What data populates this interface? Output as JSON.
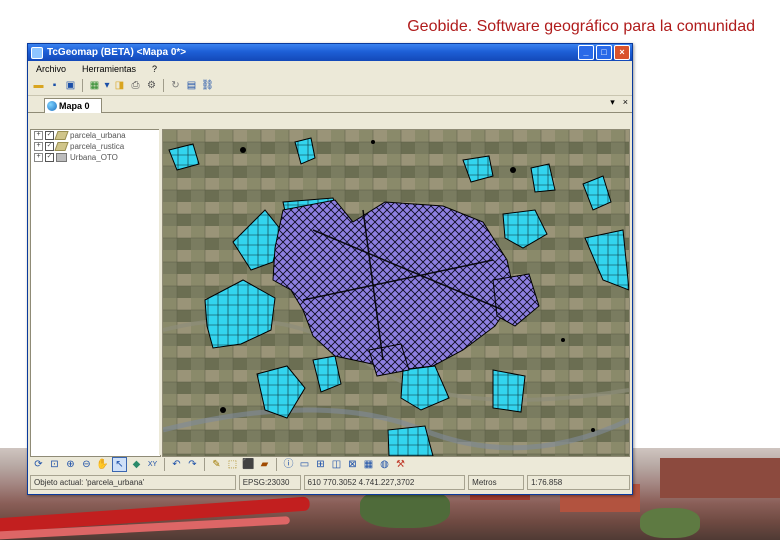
{
  "slide_title": "Geobide. Software geográfico para la comunidad",
  "window": {
    "title": "TcGeomap (BETA) <Mapa 0*>"
  },
  "window_controls": {
    "minimize": "_",
    "maximize": "□",
    "close": "×"
  },
  "menu": [
    "Archivo",
    "Herramientas",
    "?"
  ],
  "document_tab": {
    "label": "Mapa 0",
    "dropdown": "▾",
    "close": "×"
  },
  "layers": [
    {
      "name": "parcela_urbana",
      "checked": true,
      "type": "polygon"
    },
    {
      "name": "parcela_rustica",
      "checked": true,
      "type": "polygon"
    },
    {
      "name": "Urbana_OTO",
      "checked": true,
      "type": "raster"
    }
  ],
  "statusbar": {
    "selected_object": "Objeto actual: 'parcela_urbana'",
    "crs": "EPSG:23030",
    "coordinates": "610 770.3052 4.741.227,3702",
    "units": "Metros",
    "scale": "1:76.858"
  },
  "icons": {
    "toolbar": [
      "open-folder-icon",
      "save-icon",
      "save-as-icon",
      "add-layer-icon",
      "open-project-icon",
      "print-icon",
      "settings-icon",
      "refresh-icon",
      "table-icon",
      "link-icon"
    ],
    "map_tools": [
      "refresh-map-icon",
      "zoom-window-icon",
      "zoom-in-icon",
      "zoom-out-icon",
      "pan-icon",
      "select-icon",
      "cube-icon",
      "xy-icon",
      "undo-icon",
      "redo-icon",
      "edit-icon",
      "vertex-icon",
      "node-icon",
      "paint-icon",
      "info-icon",
      "measure-icon",
      "snap-icon",
      "buffer-icon",
      "query-icon",
      "select-by-attr-icon",
      "globe-icon",
      "tools-icon"
    ]
  },
  "colors": {
    "title_red": "#b01c1c",
    "urban_parcel": "#8d7fe0",
    "rustic_parcel": "#33d4ee",
    "titlebar_blue": "#1d5fd6"
  }
}
